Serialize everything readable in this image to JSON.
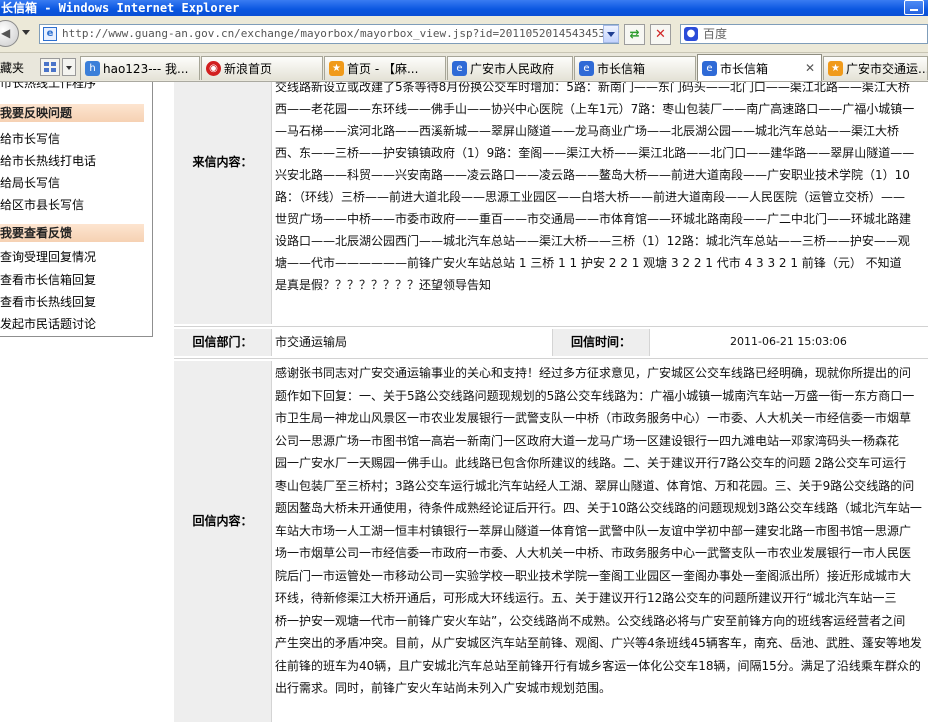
{
  "window": {
    "title": "长信箱 - Windows Internet Explorer"
  },
  "addressbar": {
    "url": "http://www.guang-an.gov.cn/exchange/mayorbox/mayorbox_view.jsp?id=20110520145434534",
    "search_placeholder": "百度"
  },
  "tabsbar": {
    "favorites_label": "藏夹",
    "tabs": [
      {
        "label": "hao123--- 我...",
        "icon": "hao123-icon",
        "color": "#3b7fd9"
      },
      {
        "label": "新浪首页",
        "icon": "sina-icon",
        "color": "#d21f1f"
      },
      {
        "label": "首页 - 【麻...",
        "icon": "star-page-icon",
        "color": "#f09a1a"
      },
      {
        "label": "广安市人民政府",
        "icon": "ie-page-icon",
        "color": "#2f6ad6"
      },
      {
        "label": "市长信箱",
        "icon": "ie-page-icon",
        "color": "#2f6ad6"
      },
      {
        "label": "市长信箱",
        "icon": "ie-page-icon",
        "color": "#2f6ad6",
        "active": true
      },
      {
        "label": "广安市交通运...",
        "icon": "star-page-icon",
        "color": "#f09a1a"
      }
    ]
  },
  "sidebar": {
    "top_link": "市长热线工作程序",
    "section1_title": "我要反映问题",
    "section1_items": [
      "给市长写信",
      "给市长热线打电话",
      "给局长写信",
      "给区市县长写信"
    ],
    "section2_title": "我要查看反馈",
    "section2_items": [
      "查询受理回复情况",
      "查看市长信箱回复",
      "查看市长热线回复",
      "发起市民话题讨论"
    ]
  },
  "letter": {
    "content_label": "来信内容：",
    "content_lines": [
      "交线路新设立或改建了5条等待8月份换公交车时增加：5路：新南门——东门码头——北门口——渠江北路——渠江大桥",
      "西——老花园——东环线——佛手山——协兴中心医院（上车1元）7路：枣山包装厂——南广高速路口——广福小城镇一",
      "—马石梯——滨河北路——西溪新城——翠屏山隧道——龙马商业广场——北辰湖公园——城北汽车总站——渠江大桥",
      "西、东——三桥——护安镇镇政府（1）9路：奎阁——渠江大桥——渠江北路——北门口——建华路——翠屏山隧道——",
      "兴安北路——科贸——兴安南路——凌云路口——凌云路——鳌岛大桥——前进大道南段——广安职业技术学院（1）10",
      "路：（环线）三桥——前进大道北段——思源工业园区——白塔大桥——前进大道南段——人民医院（运管立交桥）——",
      "世贸广场——中桥——市委市政府——重百——市交通局——市体育馆——环城北路南段——广二中北门——环城北路建",
      "设路口——北辰湖公园西门——城北汽车总站——渠江大桥——三桥（1）12路：城北汽车总站——三桥——护安——观",
      "塘——代市——————前锋广安火车站总站 1 三桥 1 1 护安 2 2 1 观塘 3 2 2 1 代市 4 3 3 2 1 前锋（元） 不知道",
      "是真是假？？？？？？？？还望领导告知"
    ],
    "dept_label": "回信部门：",
    "dept_value": "市交通运输局",
    "time_label": "回信时间：",
    "time_value": "2011-06-21 15:03:06",
    "reply_label": "回信内容：",
    "reply_lines": [
      "感谢张书同志对广安交通运输事业的关心和支持！经过多方征求意见，广安城区公交车线路已经明确，现就你所提出的问",
      "题作如下回复：一、关于5路公交线路问题现规划的5路公交车线路为：广福小城镇一城南汽车站一万盛一街一东方商口一",
      "市卫生局一神龙山风景区一市农业发展银行一武警支队一中桥（市政务服务中心）一市委、人大机关一市经信委一市烟草",
      "公司一思源广场一市图书馆一高岩一新南门一区政府大道一龙马广场一区建设银行一四九滩电站一邓家湾码头一杨森花",
      "园一广安水厂一天赐园一佛手山。此线路已包含你所建议的线路。二、关于建议开行7路公交车的问题 2路公交车可运行",
      "枣山包装厂至三桥村；3路公交车运行城北汽车站经人工湖、翠屏山隧道、体育馆、万和花园。三、关于9路公交线路的问",
      "题因鳌岛大桥未开通使用，待条件成熟经论证后开行。四、关于10路公交线路的问题现规划3路公交车线路（城北汽车站一",
      "车站大市场一人工湖一恒丰村镇银行一萃屏山隧道一体育馆一武警中队一友谊中学初中部一建安北路一市图书馆一思源广",
      "场一市烟草公司一市经信委一市政府一市委、人大机关一中桥、市政务服务中心一武警支队一市农业发展银行一市人民医",
      "院后门一市运管处一市移动公司一实验学校一职业技术学院一奎阁工业园区一奎阁办事处一奎阁派出所）接近形成城市大",
      "环线，待新修渠江大桥开通后，可形成大环线运行。五、关于建议开行12路公交车的问题所建议开行“城北汽车站一三",
      "桥一护安一观塘一代市一前锋广安火车站”，公交线路尚不成熟。公交线路必将与广安至前锋方向的班线客运经营者之间",
      "产生突出的矛盾冲突。目前，从广安城区汽车站至前锋、观阁、广兴等4条班线45辆客车，南充、岳池、武胜、蓬安等地发",
      "往前锋的班车为40辆，且广安城北汽车总站至前锋开行有城乡客运一体化公交车18辆，间隔15分。满足了沿线乘车群众的",
      "出行需求。同时，前锋广安火车站尚未列入广安城市规划范围。"
    ]
  }
}
